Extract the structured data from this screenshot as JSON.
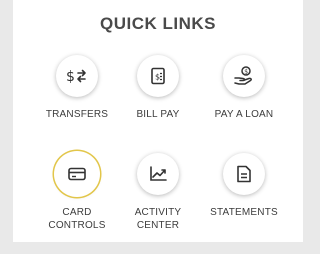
{
  "header": {
    "title": "QUICK LINKS"
  },
  "links": [
    {
      "label": "TRANSFERS",
      "icon": "transfer-icon"
    },
    {
      "label": "BILL PAY",
      "icon": "bill-icon"
    },
    {
      "label": "PAY A LOAN",
      "icon": "loan-icon"
    },
    {
      "label": "CARD\nCONTROLS",
      "icon": "card-icon",
      "highlighted": true
    },
    {
      "label": "ACTIVITY\nCENTER",
      "icon": "chart-icon"
    },
    {
      "label": "STATEMENTS",
      "icon": "statement-icon"
    }
  ],
  "colors": {
    "highlight_ring": "#e2c64a",
    "background": "#e9e9e9",
    "text": "#3c3c3c"
  }
}
